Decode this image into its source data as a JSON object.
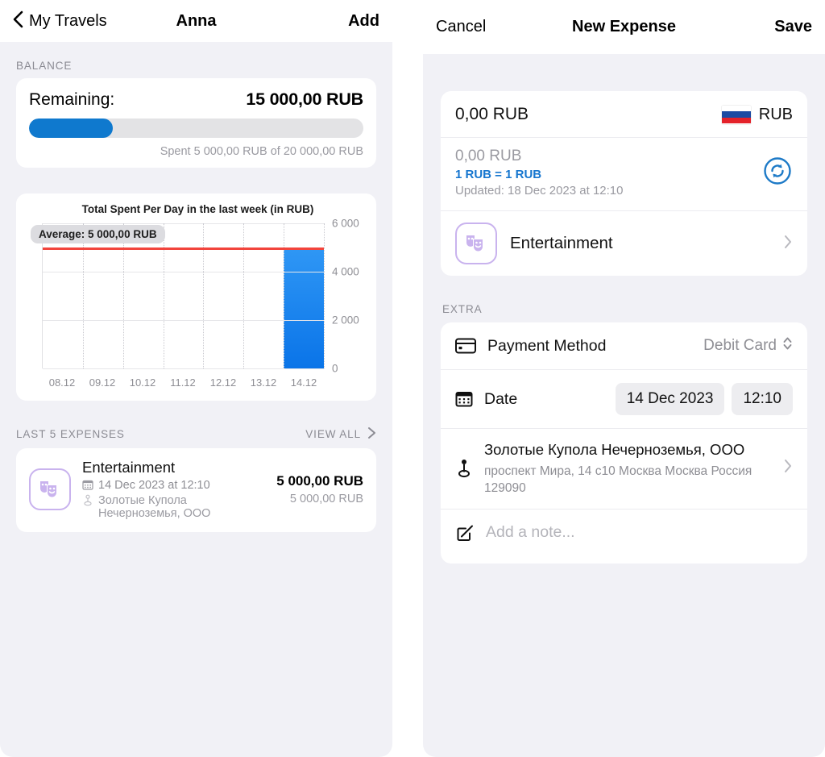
{
  "left": {
    "navbar": {
      "back_label": "My Travels",
      "title": "Anna",
      "action_label": "Add"
    },
    "balance": {
      "section_label": "BALANCE",
      "remaining_label": "Remaining:",
      "remaining_value": "15 000,00 RUB",
      "progress_percent": 25,
      "spent_text": "Spent 5 000,00 RUB of 20 000,00 RUB"
    },
    "expenses": {
      "section_label": "LAST 5 EXPENSES",
      "view_all_label": "VIEW ALL",
      "items": [
        {
          "category": "Entertainment",
          "icon": "theater-masks-icon",
          "date": "14 Dec 2023 at 12:10",
          "place_line1": "Золотые Купола",
          "place_line2": "Нечерноземья, ООО",
          "amount": "5 000,00 RUB",
          "amount_converted": "5 000,00 RUB"
        }
      ]
    }
  },
  "right": {
    "navbar": {
      "cancel_label": "Cancel",
      "title": "New Expense",
      "save_label": "Save"
    },
    "amount": {
      "value": "0,00 RUB",
      "currency_code": "RUB",
      "flag": "russia-flag-icon",
      "converted": "0,00 RUB",
      "rate": "1 RUB = 1 RUB",
      "updated": "Updated: 18 Dec 2023 at 12:10",
      "refresh_icon": "refresh-icon"
    },
    "category": {
      "name": "Entertainment",
      "icon": "theater-masks-icon"
    },
    "extra": {
      "section_label": "EXTRA",
      "payment_method": {
        "label": "Payment Method",
        "value": "Debit Card",
        "icon": "credit-card-icon"
      },
      "date": {
        "label": "Date",
        "date_value": "14 Dec 2023",
        "time_value": "12:10",
        "icon": "calendar-icon"
      },
      "location": {
        "icon": "map-pin-icon",
        "name": "Золотые Купола Нечерноземья, ООО",
        "address": "проспект Мира, 14 с10 Москва Москва Россия 129090"
      },
      "note": {
        "placeholder": "Add a note...",
        "icon": "note-edit-icon"
      }
    }
  },
  "chart_data": {
    "type": "bar",
    "title": "Total Spent Per Day in the last week (in RUB)",
    "categories": [
      "08.12",
      "09.12",
      "10.12",
      "11.12",
      "12.12",
      "13.12",
      "14.12"
    ],
    "values": [
      0,
      0,
      0,
      0,
      0,
      0,
      5000
    ],
    "ylim": [
      0,
      6000
    ],
    "yticks": [
      0,
      2000,
      4000,
      6000
    ],
    "ytick_labels": [
      "0",
      "2 000",
      "4 000",
      "6 000"
    ],
    "xlabel": "",
    "ylabel": "",
    "grid": true,
    "legend": "none",
    "annotations": [
      {
        "type": "hline",
        "value": 5000,
        "color": "#f2443c",
        "label": "Average: 5 000,00 RUB"
      }
    ],
    "bar_color": "#0a74e8",
    "yaxis_position": "right"
  },
  "colors": {
    "accent_blue": "#0f79ce",
    "link_blue": "#1676cf",
    "average_red": "#f2443c",
    "category_purple": "#c9b3ee",
    "background": "#f1f1f6"
  }
}
